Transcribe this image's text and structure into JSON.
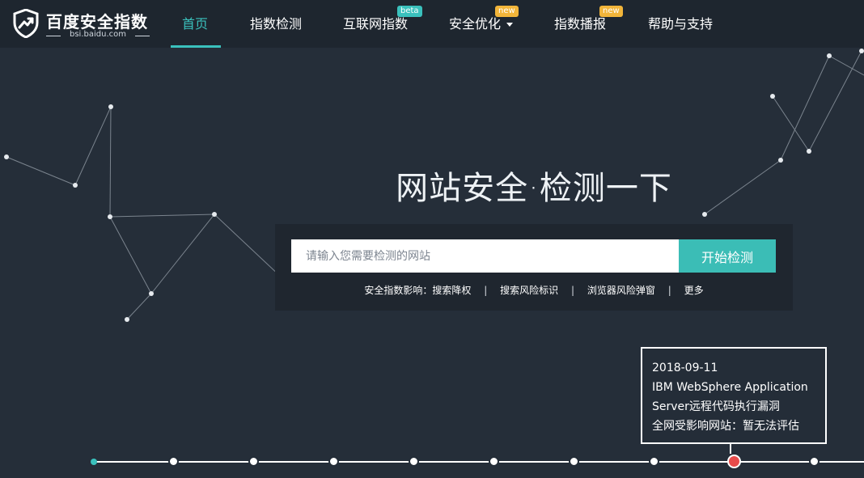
{
  "navbar": {
    "logo": {
      "brand": "百度安全指数",
      "domain": "bsi.baidu.com"
    },
    "items": [
      {
        "label": "首页",
        "active": true
      },
      {
        "label": "指数检测"
      },
      {
        "label": "互联网指数",
        "badge": "beta"
      },
      {
        "label": "安全优化",
        "badge": "new",
        "has_dropdown": true
      },
      {
        "label": "指数播报",
        "badge": "new"
      },
      {
        "label": "帮助与支持"
      }
    ]
  },
  "hero": {
    "title": "网站安全·检测一下",
    "search": {
      "placeholder": "请输入您需要检测的网站",
      "button_label": "开始检测"
    },
    "impact": {
      "prefix": "安全指数影响：",
      "links": [
        "搜索降权",
        "搜索风险标识",
        "浏览器风险弹窗",
        "更多"
      ],
      "separator": "|"
    }
  },
  "tooltip": {
    "date": "2018-09-11",
    "line1": "IBM WebSphere Application",
    "line2": "Server远程代码执行漏洞",
    "impact_label": "全网受影响网站：",
    "impact_value": "暂无法评估"
  },
  "timeline": {
    "active_index": 8,
    "dot_count": 10
  },
  "colors": {
    "accent": "#3ac1bd",
    "badge_new": "#f2b53a",
    "active_dot": "#e84b4b",
    "background": "#252e39",
    "navbar": "#1e262f"
  }
}
